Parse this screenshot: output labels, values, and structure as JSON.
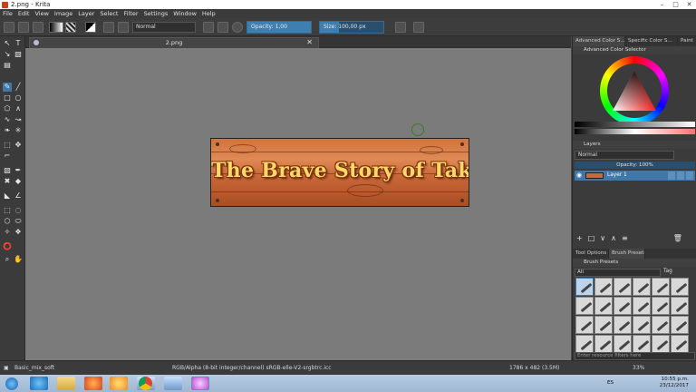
{
  "window": {
    "title": "2.png - Krita",
    "controls": [
      "–",
      "□",
      "✕"
    ]
  },
  "menu": [
    "File",
    "Edit",
    "View",
    "Image",
    "Layer",
    "Select",
    "Filter",
    "Settings",
    "Window",
    "Help"
  ],
  "toolbar": {
    "blend_mode": "Normal",
    "opacity_label": "Opacity: 1,00",
    "opacity_value": 1.0,
    "size_label": "Size: 100,00 px",
    "size_fraction": 0.3
  },
  "document": {
    "tab_name": "2.png",
    "close_glyph": "✕",
    "artwork_text": "The Brave Story of Tak",
    "artwork_colors": {
      "wood": "#d0733d",
      "lettering": "#ffd866",
      "outline": "#7a2e0a"
    }
  },
  "dock": {
    "top_tabs": [
      "Advanced Color S...",
      "Specific Color S...",
      "Paint"
    ],
    "color_selector_title": "Advanced Color Selector",
    "layers_title": "Layers",
    "layers_blend": "Normal",
    "layers_opacity": "Opacity:  100%",
    "layer_name": "Layer 1",
    "actions": [
      "+",
      "□",
      "∨",
      "∧",
      "≡",
      "🗑"
    ],
    "bottom_tabs": [
      "Tool Options",
      "Brush Presets"
    ],
    "brush_presets_title": "Brush Presets",
    "brush_filter": "All",
    "brush_tag": "Tag",
    "brush_search_placeholder": "Enter resource filters here"
  },
  "status": {
    "brush": "Basic_mix_soft",
    "color_model": "RGB/Alpha (8-bit integer/channel)  sRGB-elle-V2-srgbtrc.icc",
    "dimensions": "1786 x 482 (3.5M)",
    "zoom": "33%"
  },
  "taskbar": {
    "lang": "ES",
    "time": "10:55 p.m.",
    "date": "23/12/2017"
  },
  "icons": {
    "app": "krita-icon",
    "start": "windows-start-icon",
    "taskbar": [
      "ie-icon",
      "folder-icon",
      "firefox-icon",
      "media-player-icon",
      "file-manager-icon",
      "chrome-icon",
      "paint-icon",
      "krita-icon"
    ]
  }
}
